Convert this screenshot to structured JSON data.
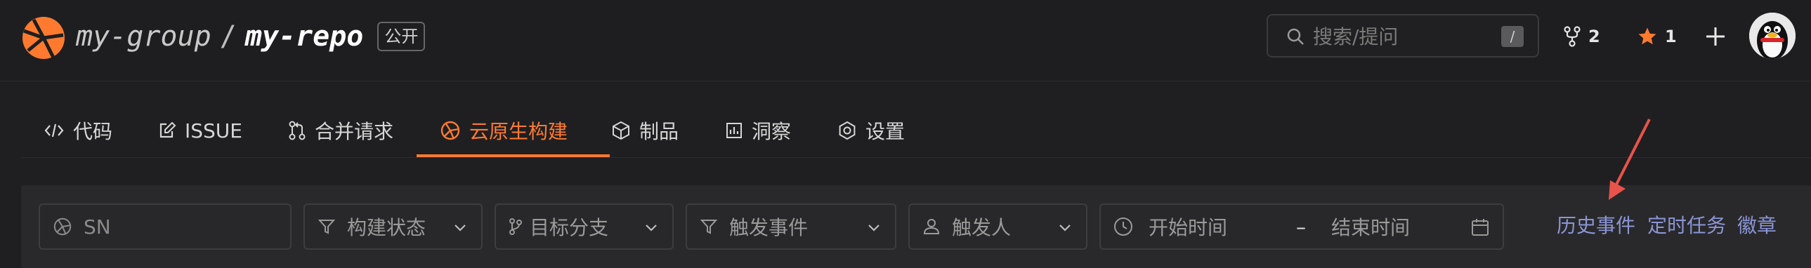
{
  "header": {
    "group": "my-group",
    "separator": "/",
    "repo": "my-repo",
    "visibility_badge": "公开",
    "search": {
      "placeholder": "搜索/提问",
      "shortcut": "/"
    },
    "forks_count": "2",
    "stars_count": "1",
    "add_icon": "plus-icon",
    "avatar_icon": "penguin-avatar"
  },
  "tabs": [
    {
      "label": "代码",
      "icon": "code-icon"
    },
    {
      "label": "ISSUE",
      "icon": "issue-edit-icon"
    },
    {
      "label": "合并请求",
      "icon": "pull-request-icon"
    },
    {
      "label": "云原生构建",
      "icon": "build-icon",
      "active": true
    },
    {
      "label": "制品",
      "icon": "package-icon"
    },
    {
      "label": "洞察",
      "icon": "chart-icon"
    },
    {
      "label": "设置",
      "icon": "settings-icon"
    }
  ],
  "filters": {
    "sn_placeholder": "SN",
    "build_status": "构建状态",
    "target_branch": "目标分支",
    "trigger_event": "触发事件",
    "trigger_user": "触发人",
    "start_time": "开始时间",
    "range_sep": "–",
    "end_time": "结束时间"
  },
  "links": {
    "history_events": "历史事件",
    "scheduled_tasks": "定时任务",
    "badges": "徽章"
  },
  "colors": {
    "accent": "#ff7a2f",
    "link": "#8b95d6",
    "background": "#1f1f21",
    "annotation_arrow": "#e8534a"
  }
}
